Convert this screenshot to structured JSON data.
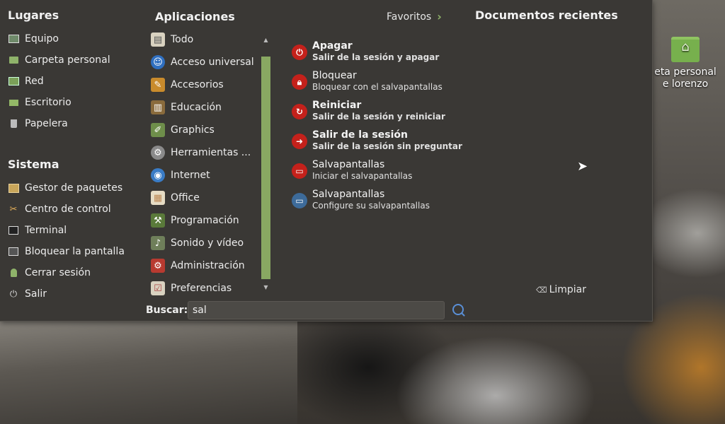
{
  "places": {
    "title": "Lugares",
    "items": [
      {
        "label": "Equipo",
        "icon": "computer-icon"
      },
      {
        "label": "Carpeta personal",
        "icon": "home-folder-icon"
      },
      {
        "label": "Red",
        "icon": "network-icon"
      },
      {
        "label": "Escritorio",
        "icon": "desktop-icon"
      },
      {
        "label": "Papelera",
        "icon": "trash-icon"
      }
    ]
  },
  "system": {
    "title": "Sistema",
    "items": [
      {
        "label": "Gestor de paquetes",
        "icon": "package-manager-icon"
      },
      {
        "label": "Centro de control",
        "icon": "control-center-icon"
      },
      {
        "label": "Terminal",
        "icon": "terminal-icon"
      },
      {
        "label": "Bloquear la pantalla",
        "icon": "lock-screen-icon"
      },
      {
        "label": "Cerrar sesión",
        "icon": "logout-icon"
      },
      {
        "label": "Salir",
        "icon": "power-icon"
      }
    ]
  },
  "applications": {
    "title": "Aplicaciones",
    "items": [
      {
        "label": "Todo",
        "icon": "all-apps-icon"
      },
      {
        "label": "Acceso universal",
        "icon": "accessibility-icon"
      },
      {
        "label": "Accesorios",
        "icon": "accessories-icon"
      },
      {
        "label": "Educación",
        "icon": "education-icon"
      },
      {
        "label": "Graphics",
        "icon": "graphics-icon"
      },
      {
        "label": "Herramientas ...",
        "icon": "tools-icon"
      },
      {
        "label": "Internet",
        "icon": "internet-icon"
      },
      {
        "label": "Office",
        "icon": "office-icon"
      },
      {
        "label": "Programación",
        "icon": "programming-icon"
      },
      {
        "label": "Sonido y vídeo",
        "icon": "multimedia-icon"
      },
      {
        "label": "Administración",
        "icon": "administration-icon"
      },
      {
        "label": "Preferencias",
        "icon": "preferences-icon"
      }
    ]
  },
  "favorites_link": "Favoritos",
  "results": [
    {
      "title": "Apagar",
      "desc": "Salir de la sesión y apagar",
      "icon": "power-icon",
      "bold": true
    },
    {
      "title": "Bloquear",
      "desc": "Bloquear con el salvapantallas",
      "icon": "lock-icon",
      "bold": false
    },
    {
      "title": "Reiniciar",
      "desc": "Salir de la sesión y reiniciar",
      "icon": "restart-icon",
      "bold": true
    },
    {
      "title": "Salir de la sesión",
      "desc": "Salir de la sesión sin preguntar",
      "icon": "logout-icon",
      "bold": true
    },
    {
      "title": "Salvapantallas",
      "desc": "Iniciar el salvapantallas",
      "icon": "screensaver-icon",
      "bold": false
    },
    {
      "title": "Salvapantallas",
      "desc": "Configure su salvapantallas",
      "icon": "screensaver-config-icon",
      "bold": false
    }
  ],
  "recent": {
    "title": "Documentos recientes",
    "clear_label": "Limpiar"
  },
  "search": {
    "label": "Buscar:",
    "value": "sal"
  },
  "desktop_icon": {
    "line1": "eta personal",
    "line2": "e lorenzo"
  },
  "colors": {
    "accent": "#89a862",
    "panel": "#3a3835",
    "danger": "#c4211b"
  }
}
